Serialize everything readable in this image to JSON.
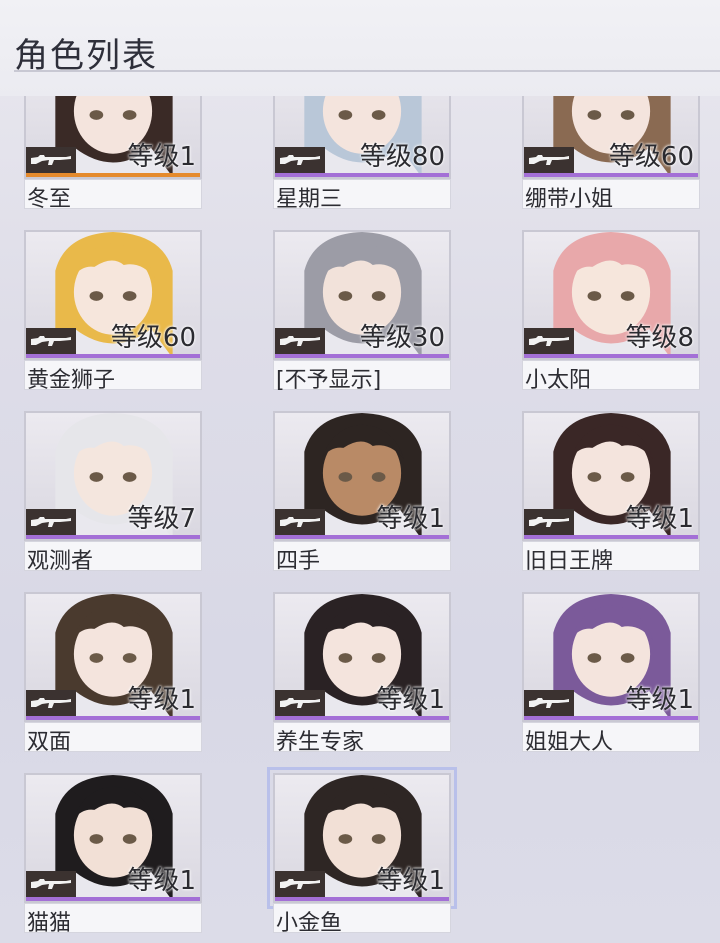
{
  "header": {
    "title": "角色列表"
  },
  "characters": [
    {
      "name": "冬至",
      "level": "等级1",
      "stripe": "#e58a2c",
      "hair": "#3a2a26",
      "skin": "#f4e4dd"
    },
    {
      "name": "星期三",
      "level": "等级80",
      "stripe": "#a36fd6",
      "hair": "#b9c7d8",
      "skin": "#f4e4dd"
    },
    {
      "name": "绷带小姐",
      "level": "等级60",
      "stripe": "#a36fd6",
      "hair": "#8a6a52",
      "skin": "#f4e4dd"
    },
    {
      "name": "黄金狮子",
      "level": "等级60",
      "stripe": "#a36fd6",
      "hair": "#e9b94a",
      "skin": "#f6e6dc"
    },
    {
      "name": "[不予显示]",
      "level": "等级30",
      "stripe": "#a36fd6",
      "hair": "#9c9ca6",
      "skin": "#f2e2da"
    },
    {
      "name": "小太阳",
      "level": "等级8",
      "stripe": "#a36fd6",
      "hair": "#e8a8aa",
      "skin": "#f6e6dc"
    },
    {
      "name": "观测者",
      "level": "等级7",
      "stripe": "#a36fd6",
      "hair": "#e6e6ea",
      "skin": "#f4e6de"
    },
    {
      "name": "四手",
      "level": "等级1",
      "stripe": "#a36fd6",
      "hair": "#2d2522",
      "skin": "#b98a66"
    },
    {
      "name": "旧日王牌",
      "level": "等级1",
      "stripe": "#a36fd6",
      "hair": "#3a2726",
      "skin": "#f4e4dd"
    },
    {
      "name": "双面",
      "level": "等级1",
      "stripe": "#a36fd6",
      "hair": "#4a3a2e",
      "skin": "#f4e4dd"
    },
    {
      "name": "养生专家",
      "level": "等级1",
      "stripe": "#a36fd6",
      "hair": "#2a2224",
      "skin": "#f4e4dd"
    },
    {
      "name": "姐姐大人",
      "level": "等级1",
      "stripe": "#a36fd6",
      "hair": "#7b5a9a",
      "skin": "#f4e4dd"
    },
    {
      "name": "猫猫",
      "level": "等级1",
      "stripe": "#a36fd6",
      "hair": "#1f1c1e",
      "skin": "#f2e0d6"
    },
    {
      "name": "小金鱼",
      "level": "等级1",
      "stripe": "#a36fd6",
      "hair": "#2e2624",
      "skin": "#f2e0d6",
      "selected": true
    }
  ]
}
